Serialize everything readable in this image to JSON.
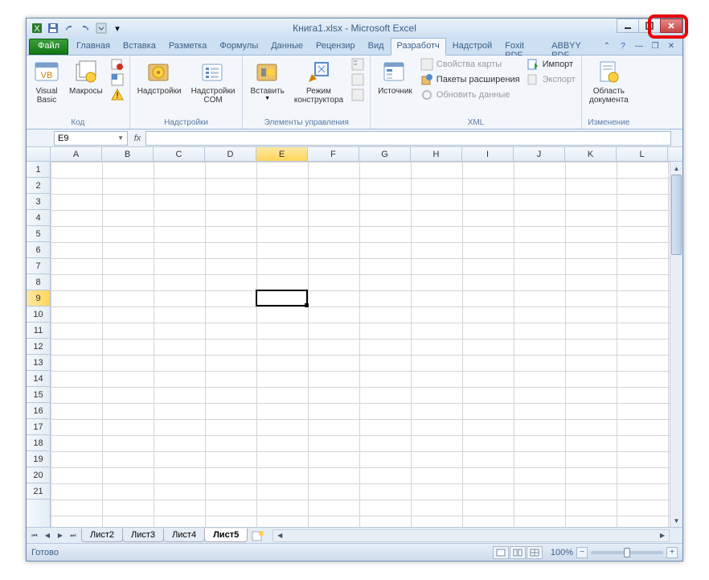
{
  "title": "Книга1.xlsx  -  Microsoft Excel",
  "tabs": {
    "file": "Файл",
    "items": [
      "Главная",
      "Вставка",
      "Разметка",
      "Формулы",
      "Данные",
      "Рецензир",
      "Вид",
      "Разработч",
      "Надстрой",
      "Foxit PDF",
      "ABBYY PDF"
    ],
    "active_index": 7
  },
  "ribbon": {
    "code": {
      "label": "Код",
      "vb": "Visual\nBasic",
      "macros": "Макросы"
    },
    "addins": {
      "label": "Надстройки",
      "addins": "Надстройки",
      "com": "Надстройки\nCOM"
    },
    "controls": {
      "label": "Элементы управления",
      "insert": "Вставить",
      "design": "Режим\nконструктора"
    },
    "xml": {
      "label": "XML",
      "source": "Источник",
      "map_props": "Свойства карты",
      "expansion": "Пакеты расширения",
      "refresh": "Обновить данные",
      "import": "Импорт",
      "export": "Экспорт"
    },
    "change": {
      "label": "Изменение",
      "doc_panel": "Область\nдокумента"
    }
  },
  "name_box": "E9",
  "active_cell": {
    "col": 4,
    "row": 8
  },
  "columns": [
    "A",
    "B",
    "C",
    "D",
    "E",
    "F",
    "G",
    "H",
    "I",
    "J",
    "K",
    "L"
  ],
  "rows": 21,
  "sheets": {
    "items": [
      "Лист2",
      "Лист3",
      "Лист4",
      "Лист5"
    ],
    "active_index": 3
  },
  "status": "Готово",
  "zoom": "100%"
}
